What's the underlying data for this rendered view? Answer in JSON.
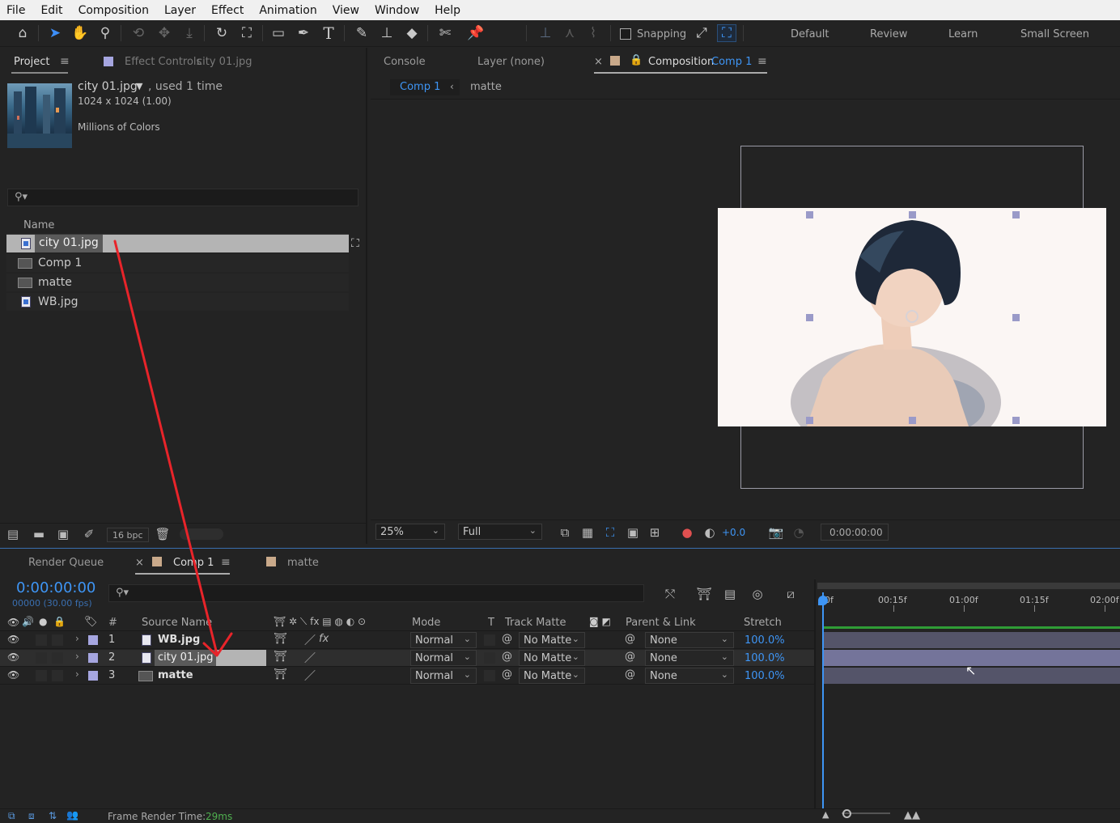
{
  "menu": [
    "File",
    "Edit",
    "Composition",
    "Layer",
    "Effect",
    "Animation",
    "View",
    "Window",
    "Help"
  ],
  "toolbar": {
    "snapping_label": "Snapping",
    "workspaces": [
      "Default",
      "Review",
      "Learn",
      "Small Screen"
    ]
  },
  "project_panel": {
    "tab_project": "Project",
    "tab_effect_controls": "Effect Controls",
    "effect_controls_target": "city 01.jpg",
    "preview": {
      "name": "city 01.jpg",
      "used": ", used 1 time",
      "size": "1024 x 1024 (1.00)",
      "colors": "Millions of Colors"
    },
    "column_name": "Name",
    "items": [
      {
        "name": "city 01.jpg",
        "type": "image",
        "selected": true
      },
      {
        "name": "Comp 1",
        "type": "comp",
        "selected": false
      },
      {
        "name": "matte",
        "type": "comp",
        "selected": false
      },
      {
        "name": "WB.jpg",
        "type": "image",
        "selected": false
      }
    ],
    "bpc": "16 bpc"
  },
  "viewer": {
    "tab_console": "Console",
    "tab_layer": "Layer (none)",
    "tab_composition": "Composition",
    "comp_name": "Comp 1",
    "breadcrumbs": [
      "Comp 1",
      "matte"
    ],
    "zoom": "25%",
    "resolution": "Full",
    "exposure": "+0.0",
    "timecode": "0:00:00:00"
  },
  "timeline": {
    "tab_render_queue": "Render Queue",
    "tab_comp": "Comp 1",
    "tab_matte": "matte",
    "current_time": "0:00:00:00",
    "frame_info": "00000 (30.00 fps)",
    "columns": {
      "num": "#",
      "source_name": "Source Name",
      "mode": "Mode",
      "t": "T",
      "track_matte": "Track Matte",
      "parent": "Parent & Link",
      "stretch": "Stretch"
    },
    "layers": [
      {
        "num": "1",
        "name": "WB.jpg",
        "mode": "Normal",
        "matte": "No Matte",
        "parent": "None",
        "stretch": "100.0%",
        "type": "image",
        "fx": true
      },
      {
        "num": "2",
        "name": "city 01.jpg",
        "mode": "Normal",
        "matte": "No Matte",
        "parent": "None",
        "stretch": "100.0%",
        "type": "image",
        "fx": false
      },
      {
        "num": "3",
        "name": "matte",
        "mode": "Normal",
        "matte": "No Matte",
        "parent": "None",
        "stretch": "100.0%",
        "type": "comp",
        "fx": false
      }
    ],
    "ruler": [
      "0f",
      "00:15f",
      "01:00f",
      "01:15f",
      "02:00f"
    ],
    "status_label": "Frame Render Time:",
    "status_value": "29ms"
  },
  "colors": {
    "accent": "#3e95f5",
    "label_lavender": "#a6a6e0",
    "label_tan": "#c9a98a",
    "annotation_arrow": "#e8242a",
    "work_area_green": "#2f9c36"
  }
}
